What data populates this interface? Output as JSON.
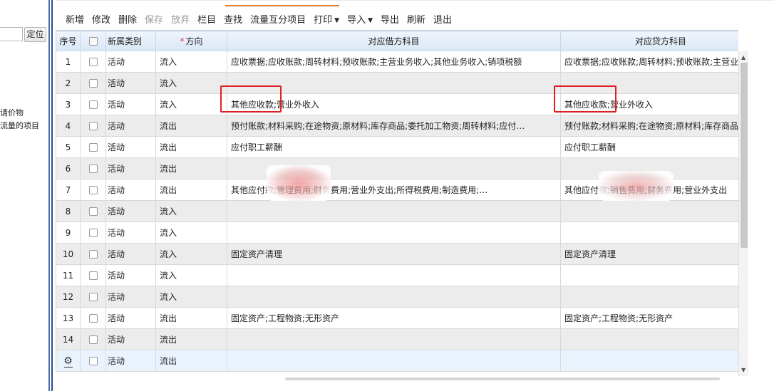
{
  "left_panel": {
    "locate_button": "定位",
    "text_line1": "请价物",
    "text_line2": "流量的项目"
  },
  "toolbar": {
    "items": [
      {
        "label": "新增",
        "enabled": true
      },
      {
        "label": "修改",
        "enabled": true
      },
      {
        "label": "删除",
        "enabled": true
      },
      {
        "label": "保存",
        "enabled": false
      },
      {
        "label": "放弃",
        "enabled": false
      },
      {
        "label": "栏目",
        "enabled": true
      },
      {
        "label": "查找",
        "enabled": true
      },
      {
        "label": "流量互分项目",
        "enabled": true
      },
      {
        "label": "打印",
        "enabled": true,
        "dropdown": true
      },
      {
        "label": "导入",
        "enabled": true,
        "dropdown": true
      },
      {
        "label": "导出",
        "enabled": true
      },
      {
        "label": "刷新",
        "enabled": true
      },
      {
        "label": "退出",
        "enabled": true
      }
    ]
  },
  "grid": {
    "headers": {
      "seq": "序号",
      "category": "新属类别",
      "required_mark": "*",
      "direction": "方向",
      "debit": "对应借方科目",
      "credit": "对应贷方科目"
    },
    "rows": [
      {
        "seq": "1",
        "category": "活动",
        "direction": "流入",
        "debit": "应收票据;应收账款;周转材料;预收账款;主营业务收入;其他业务收入;销项税额",
        "credit": "应收票据;应收账款;周转材料;预收账款;主营业务收入"
      },
      {
        "seq": "2",
        "category": "活动",
        "direction": "流入",
        "debit": "",
        "credit": ""
      },
      {
        "seq": "3",
        "category": "活动",
        "direction": "流入",
        "debit": "其他应收款;营业外收入",
        "credit": "其他应收款;营业外收入"
      },
      {
        "seq": "4",
        "category": "活动",
        "direction": "流出",
        "debit": "预付账款;材料采购;在途物资;原材料;库存商品;委托加工物资;周转材料;应付…",
        "credit": "预付账款;材料采购;在途物资;原材料;库存商品"
      },
      {
        "seq": "5",
        "category": "活动",
        "direction": "流出",
        "debit": "应付职工薪酬",
        "credit": "应付职工薪酬"
      },
      {
        "seq": "6",
        "category": "活动",
        "direction": "流出",
        "debit": "",
        "credit": ""
      },
      {
        "seq": "7",
        "category": "活动",
        "direction": "流出",
        "debit": "其他应付款;管理费用;财务费用;营业外支出;所得税费用;制造费用;…",
        "credit": "其他应付款;销售费用;财务费用;营业外支出"
      },
      {
        "seq": "8",
        "category": "活动",
        "direction": "流入",
        "debit": "",
        "credit": ""
      },
      {
        "seq": "9",
        "category": "活动",
        "direction": "流入",
        "debit": "",
        "credit": ""
      },
      {
        "seq": "10",
        "category": "活动",
        "direction": "流入",
        "debit": "固定资产清理",
        "credit": "固定资产清理"
      },
      {
        "seq": "11",
        "category": "活动",
        "direction": "流入",
        "debit": "",
        "credit": ""
      },
      {
        "seq": "12",
        "category": "活动",
        "direction": "流入",
        "debit": "",
        "credit": ""
      },
      {
        "seq": "13",
        "category": "活动",
        "direction": "流出",
        "debit": "固定资产;工程物资;无形资产",
        "credit": "固定资产;工程物资;无形资产"
      },
      {
        "seq": "14",
        "category": "活动",
        "direction": "流出",
        "debit": "",
        "credit": ""
      },
      {
        "seq": "",
        "category": "活动",
        "direction": "流出",
        "debit": "",
        "credit": "",
        "gear_icon": "gear-icon",
        "selected": true
      }
    ]
  },
  "colors": {
    "highlight_box": "#e02020",
    "header_bg": "#dbe7f6",
    "alt_row_bg": "#ececec",
    "selected_row_bg": "#eaf3fd",
    "accent_tab": "#e47d2c"
  }
}
